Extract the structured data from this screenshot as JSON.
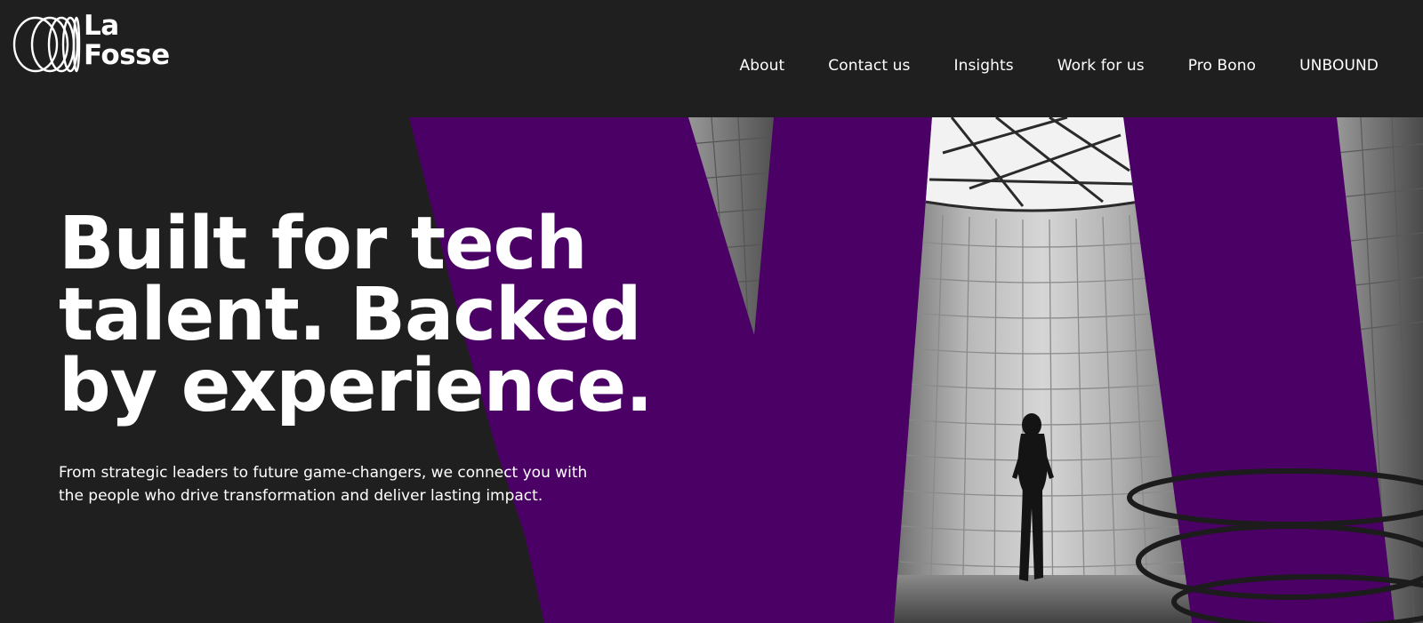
{
  "brand": {
    "logo_line1": "La",
    "logo_line2": "Fosse",
    "logo_icon": "concentric-ellipses-icon"
  },
  "nav": {
    "items": [
      {
        "label": "About"
      },
      {
        "label": "Contact us"
      },
      {
        "label": "Insights"
      },
      {
        "label": "Work for us"
      },
      {
        "label": "Pro Bono"
      },
      {
        "label": "UNBOUND"
      }
    ]
  },
  "hero": {
    "heading_lines": [
      "Built for tech",
      "talent. Backed",
      "by experience."
    ],
    "subtext_lines": [
      "From strategic leaders to future game-changers, we connect you with",
      "the people who drive transformation and deliver lasting impact."
    ],
    "image": "black-and-white photo of a woman walking in a tiled domed hall with a skylight"
  },
  "colors": {
    "background": "#1f1f1f",
    "accent_purple": "#4b0066",
    "text": "#ffffff"
  }
}
